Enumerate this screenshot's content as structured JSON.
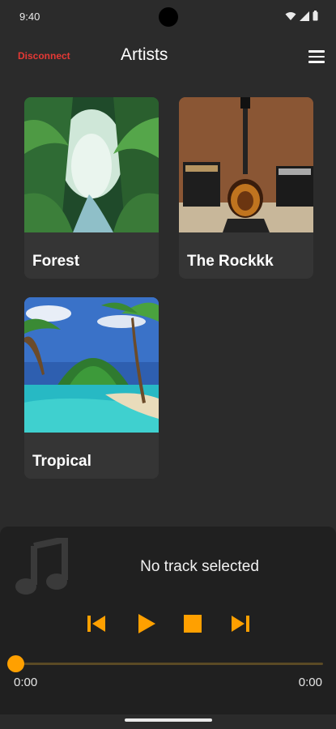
{
  "status": {
    "time": "9:40",
    "icons": [
      "wifi-icon",
      "signal-icon",
      "battery-icon"
    ]
  },
  "appbar": {
    "disconnect_label": "Disconnect",
    "title": "Artists",
    "menu_icon": "menu-icon"
  },
  "artists": [
    {
      "name": "Forest"
    },
    {
      "name": "The Rockkk"
    },
    {
      "name": "Tropical"
    }
  ],
  "player": {
    "now_playing": "No track selected",
    "current_time": "0:00",
    "total_time": "0:00",
    "progress": 0,
    "controls": [
      "skip-previous-icon",
      "play-icon",
      "stop-icon",
      "skip-next-icon"
    ]
  },
  "colors": {
    "accent": "#ffa000",
    "danger": "#e53935",
    "background": "#2b2b2b",
    "card": "#353535"
  }
}
